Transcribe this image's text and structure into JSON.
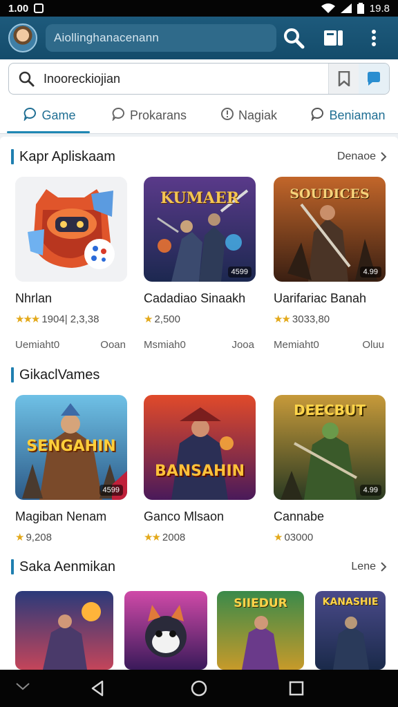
{
  "status": {
    "time": "1.00",
    "battery": "19.8"
  },
  "header": {
    "search_text": "Aiollinghanacenann"
  },
  "search": {
    "value": "Inooreckiojian"
  },
  "tabs": [
    {
      "label": "Game",
      "icon": "chat-bubble-icon",
      "active": true
    },
    {
      "label": "Prokarans",
      "icon": "chat-bubble-icon",
      "active": false
    },
    {
      "label": "Nagiak",
      "icon": "info-circle-icon",
      "active": false
    },
    {
      "label": "Beniaman",
      "icon": "chat-bubble-icon",
      "active": false
    }
  ],
  "sections": [
    {
      "title": "Kapr Apliskaam",
      "more": "Denaoe",
      "cards": [
        {
          "name": "Nhrlan",
          "stars": "★★★",
          "rating": "1904| 2,3,38",
          "meta_left": "Uemiaht0",
          "meta_right": "Ooan",
          "thumb_text": ""
        },
        {
          "name": "Cadadiao Sinaakh",
          "stars": "★",
          "rating": "2,500",
          "meta_left": "Msmiah0",
          "meta_right": "Jooa",
          "thumb_text": "KUMAER",
          "badge": "4599"
        },
        {
          "name": "Uarifariac Banah",
          "stars": "★★",
          "rating": "3033,80",
          "meta_left": "Memiaht0",
          "meta_right": "Oluu",
          "thumb_text": "SOUDICES",
          "badge": "4.99"
        }
      ]
    },
    {
      "title": "GikaclVames",
      "more": "",
      "cards": [
        {
          "name": "Magiban Nenam",
          "stars": "★",
          "rating": "9,208",
          "thumb_text": "SENGAHIN",
          "badge": "4599"
        },
        {
          "name": "Ganco Mlsaon",
          "stars": "★★",
          "rating": "2008",
          "thumb_text": "BANSAHIN",
          "badge": ""
        },
        {
          "name": "Cannabe",
          "stars": "★",
          "rating": "03000",
          "thumb_text": "DEECBUT",
          "badge": "4.99"
        }
      ]
    },
    {
      "title": "Saka Aenmikan",
      "more": "Lene",
      "cards": [
        {
          "thumb_text": ""
        },
        {
          "thumb_text": ""
        },
        {
          "thumb_text": "SIIEDUR"
        },
        {
          "thumb_text": "KANASHIE"
        }
      ]
    }
  ],
  "colors": {
    "appbar": "#1a5677",
    "accent": "#1f87b3",
    "star": "#e3a91b"
  }
}
